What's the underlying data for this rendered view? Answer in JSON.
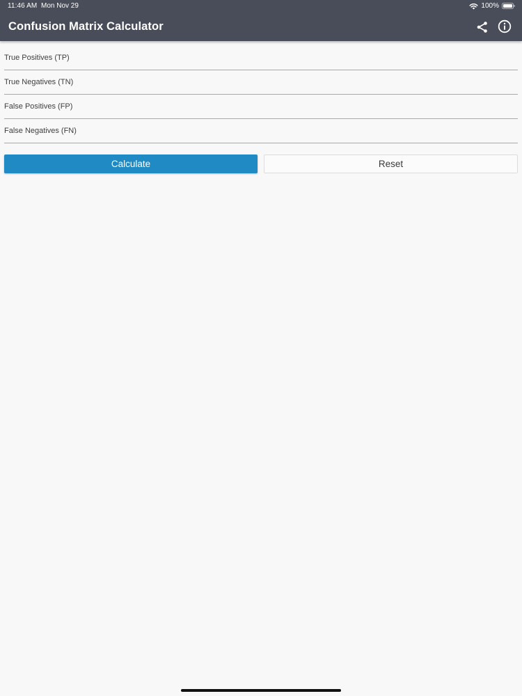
{
  "status_bar": {
    "time": "11:46 AM",
    "date": "Mon Nov 29",
    "battery_text": "100%"
  },
  "header": {
    "title": "Confusion Matrix Calculator",
    "share_icon": "share-icon",
    "info_icon": "info-icon",
    "background_color": "#494c59"
  },
  "form": {
    "fields": [
      {
        "placeholder": "True Positives (TP)",
        "value": ""
      },
      {
        "placeholder": "True Negatives (TN)",
        "value": ""
      },
      {
        "placeholder": "False Positives (FP)",
        "value": ""
      },
      {
        "placeholder": "False Negatives (FN)",
        "value": ""
      }
    ]
  },
  "actions": {
    "calculate_label": "Calculate",
    "reset_label": "Reset",
    "calculate_color": "#1f8ac3"
  }
}
